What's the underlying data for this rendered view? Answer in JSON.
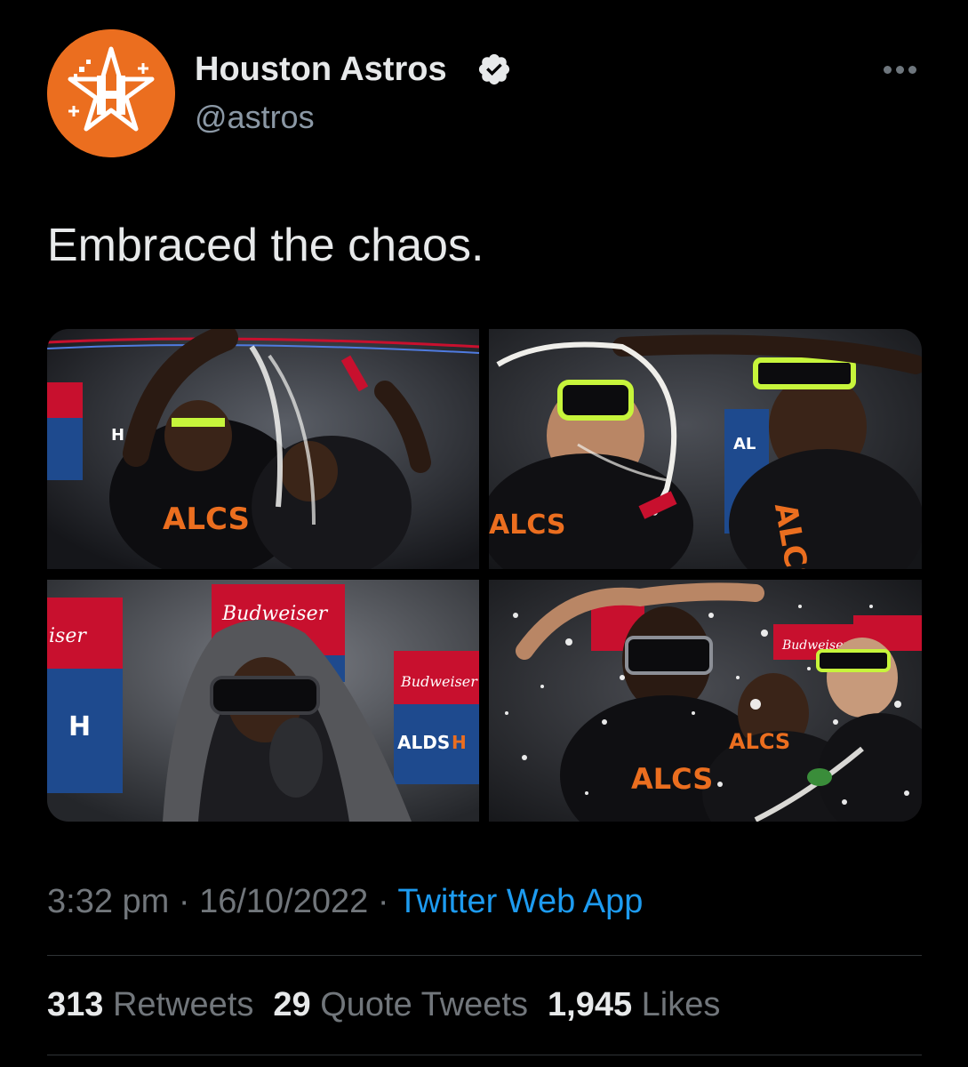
{
  "author": {
    "display_name": "Houston Astros",
    "handle": "@astros",
    "avatar_icon": "astros-logo-icon",
    "avatar_color": "#eb6e1f",
    "verified": true
  },
  "tweet": {
    "text": "Embraced the chaos.",
    "media": [
      {
        "name": "celebration-photo-1",
        "signs": [
          "ALCS",
          "H"
        ]
      },
      {
        "name": "celebration-photo-2",
        "signs": [
          "ALCS",
          "AL"
        ]
      },
      {
        "name": "celebration-photo-3",
        "signs": [
          "Budweiser",
          "ALDS",
          "H"
        ]
      },
      {
        "name": "celebration-photo-4",
        "signs": [
          "ALCS",
          "Budweiser"
        ]
      }
    ]
  },
  "meta": {
    "time": "3:32 pm",
    "separator": "·",
    "date": "16/10/2022",
    "source": "Twitter Web App"
  },
  "stats": {
    "retweets_count": "313",
    "retweets_label": "Retweets",
    "quotes_count": "29",
    "quotes_label": "Quote Tweets",
    "likes_count": "1,945",
    "likes_label": "Likes"
  },
  "colors": {
    "background": "#000000",
    "text": "#e7e9ea",
    "muted": "#71767b",
    "link": "#1d9bf0",
    "astros_orange": "#eb6e1f",
    "astros_navy": "#002d62"
  }
}
